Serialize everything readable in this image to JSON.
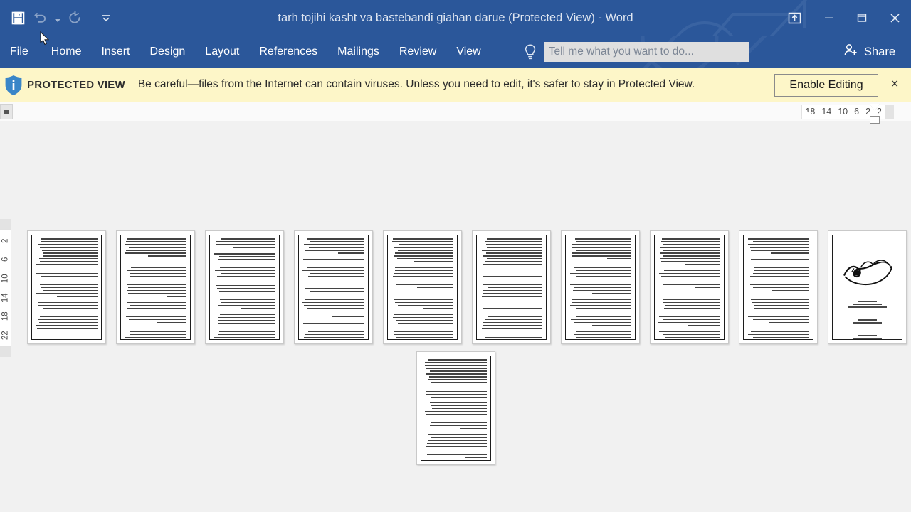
{
  "window": {
    "title": "tarh tojihi kasht va bastebandi giahan darue (Protected View) - Word",
    "accent_color": "#2b579a",
    "controls": {
      "ribbon_display_options": "ribbon-display-options",
      "minimize": "minimize",
      "restore": "restore",
      "close": "close"
    }
  },
  "quick_access": {
    "save": "Save",
    "undo": "Undo",
    "redo": "Redo",
    "customize": "Customize Quick Access Toolbar"
  },
  "ribbon": {
    "tabs": [
      {
        "label": "File"
      },
      {
        "label": "Home"
      },
      {
        "label": "Insert"
      },
      {
        "label": "Design"
      },
      {
        "label": "Layout"
      },
      {
        "label": "References"
      },
      {
        "label": "Mailings"
      },
      {
        "label": "Review"
      },
      {
        "label": "View"
      }
    ],
    "tellme": {
      "value": "",
      "placeholder": "Tell me what you want to do..."
    },
    "share_label": "Share"
  },
  "protected_view": {
    "badge": "PROTECTED VIEW",
    "message": "Be careful—files from the Internet can contain viruses. Unless you need to edit, it's safer to stay in Protected View.",
    "enable_button": "Enable Editing",
    "close": "×",
    "bar_color": "#fdf6c8"
  },
  "ruler": {
    "horizontal_ticks": [
      "18",
      "14",
      "10",
      "6",
      "2",
      "2"
    ],
    "vertical_ticks": [
      "2",
      "2",
      "6",
      "10",
      "14",
      "18",
      "22"
    ]
  },
  "document": {
    "view_mode": "multiple-pages",
    "page_count": 11,
    "rows": [
      {
        "pages": [
          {
            "kind": "text",
            "paragraphs": [
              11,
              9,
              12,
              5
            ]
          },
          {
            "kind": "text",
            "paragraphs": [
              7,
              13,
              8,
              6
            ]
          },
          {
            "kind": "text",
            "paragraphs": [
              4,
              10,
              9,
              10
            ]
          },
          {
            "kind": "text",
            "paragraphs": [
              6,
              9,
              11,
              7
            ]
          },
          {
            "kind": "text",
            "paragraphs": [
              9,
              8,
              6,
              12
            ]
          },
          {
            "kind": "text",
            "paragraphs": [
              12,
              10,
              9,
              7
            ]
          },
          {
            "kind": "text",
            "paragraphs": [
              8,
              11,
              10,
              8
            ]
          },
          {
            "kind": "text",
            "paragraphs": [
              10,
              7,
              12,
              9
            ]
          },
          {
            "kind": "text",
            "paragraphs": [
              6,
              12,
              10,
              9
            ]
          },
          {
            "kind": "title",
            "paragraphs": [
              3,
              2,
              4
            ]
          }
        ]
      },
      {
        "pages": [
          {
            "kind": "text",
            "paragraphs": [
              10,
              14,
              9,
              5
            ]
          }
        ]
      }
    ]
  }
}
